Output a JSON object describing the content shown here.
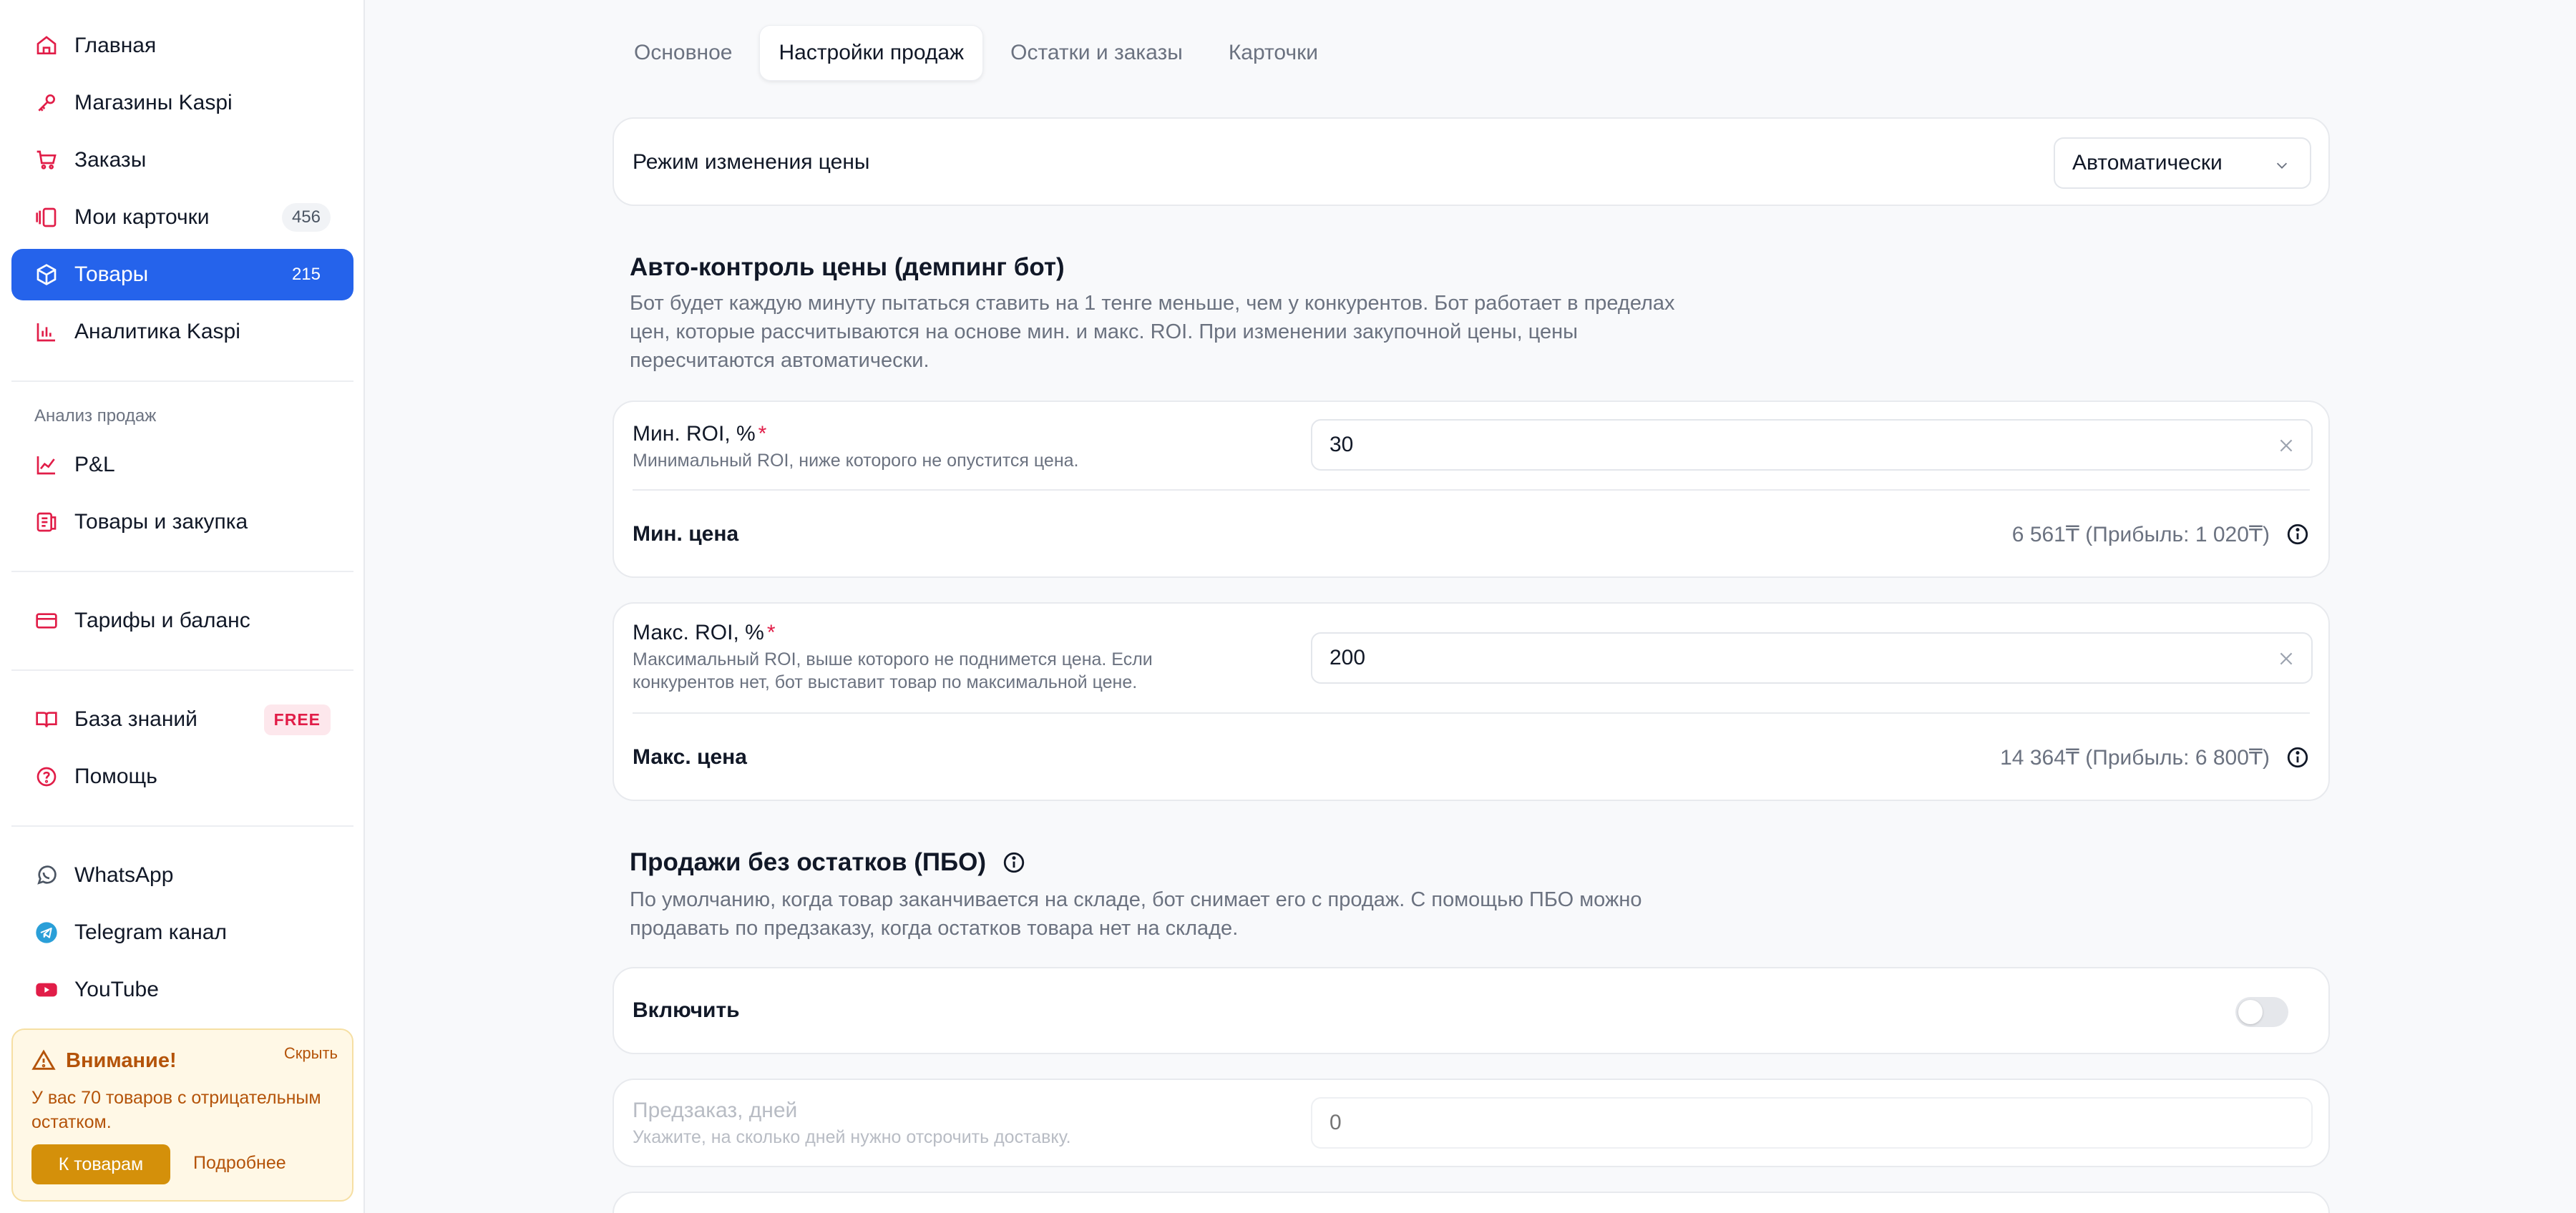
{
  "sidebar": {
    "items": [
      {
        "label": "Главная",
        "icon": "home-icon"
      },
      {
        "label": "Магазины Kaspi",
        "icon": "key-icon"
      },
      {
        "label": "Заказы",
        "icon": "cart-icon"
      },
      {
        "label": "Мои карточки",
        "icon": "cards-icon",
        "count": "456"
      },
      {
        "label": "Товары",
        "icon": "box-icon",
        "count": "215",
        "active": true
      },
      {
        "label": "Аналитика Kaspi",
        "icon": "bar-chart-icon"
      }
    ],
    "sales_section_label": "Анализ продаж",
    "sales_items": [
      {
        "label": "P&L",
        "icon": "line-chart-icon"
      },
      {
        "label": "Товары и закупка",
        "icon": "scroll-icon"
      }
    ],
    "billing_item": {
      "label": "Тарифы и баланс",
      "icon": "credit-card-icon"
    },
    "help_items": [
      {
        "label": "База знаний",
        "icon": "book-icon",
        "badge": "FREE"
      },
      {
        "label": "Помощь",
        "icon": "help-circle-icon"
      }
    ],
    "social_items": [
      {
        "label": "WhatsApp",
        "icon": "whatsapp-icon"
      },
      {
        "label": "Telegram канал",
        "icon": "telegram-icon"
      },
      {
        "label": "YouTube",
        "icon": "youtube-icon"
      }
    ],
    "alert": {
      "title": "Внимание!",
      "hide": "Скрыть",
      "text": "У вас 70 товаров с отрицательным остатком.",
      "button": "К товарам",
      "more": "Подробнее"
    }
  },
  "tabs": [
    {
      "label": "Основное"
    },
    {
      "label": "Настройки продаж",
      "active": true
    },
    {
      "label": "Остатки и заказы"
    },
    {
      "label": "Карточки"
    }
  ],
  "price_mode": {
    "label": "Режим изменения цены",
    "value": "Автоматически"
  },
  "auto_control": {
    "title": "Авто-контроль цены (демпинг бот)",
    "description": "Бот будет каждую минуту пытаться ставить на 1 тенге меньше, чем у конкурентов. Бот работает в пределах цен, которые рассчитываются на основе мин. и макс. ROI. При изменении закупочной цены, цены пересчитаются автоматически."
  },
  "min_roi": {
    "label": "Мин. ROI, %",
    "required": "*",
    "hint": "Минимальный ROI, ниже которого не опустится цена.",
    "value": "30",
    "price_label": "Мин. цена",
    "price_value": "6 561₸ (Прибыль: 1 020₸)"
  },
  "max_roi": {
    "label": "Макс. ROI, %",
    "required": "*",
    "hint": "Максимальный ROI, выше которого не поднимется цена. Если конкурентов нет, бот выставит товар по максимальной цене.",
    "value": "200",
    "price_label": "Макс. цена",
    "price_value": "14 364₸ (Прибыль: 6 800₸)"
  },
  "pbo": {
    "title": "Продажи без остатков (ПБО)",
    "description": "По умолчанию, когда товар заканчивается на складе, бот снимает его с продаж. С помощью ПБО можно продавать по предзаказу, когда остатков товара нет на складе.",
    "enable_label": "Включить",
    "enabled": false,
    "preorder_label": "Предзаказ, дней",
    "preorder_hint": "Укажите, на сколько дней нужно отсрочить доставку.",
    "preorder_placeholder": "0"
  },
  "colors": {
    "accent": "#2563eb",
    "icon_red": "#e11d48",
    "warning": "#b45309"
  }
}
